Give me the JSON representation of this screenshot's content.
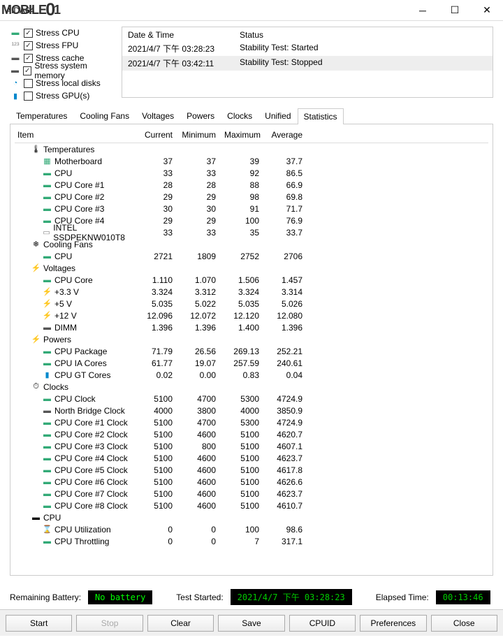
{
  "window": {
    "title": "AIDA64"
  },
  "watermark": "MOBILE01",
  "stress": {
    "items": [
      {
        "icon": "cpu",
        "label": "Stress CPU",
        "checked": true
      },
      {
        "icon": "fpu",
        "label": "Stress FPU",
        "checked": true
      },
      {
        "icon": "cache",
        "label": "Stress cache",
        "checked": true
      },
      {
        "icon": "mem",
        "label": "Stress system memory",
        "checked": true
      },
      {
        "icon": "disk",
        "label": "Stress local disks",
        "checked": false
      },
      {
        "icon": "gpu",
        "label": "Stress GPU(s)",
        "checked": false
      }
    ]
  },
  "log": {
    "headers": {
      "datetime": "Date & Time",
      "status": "Status"
    },
    "rows": [
      {
        "dt": "2021/4/7 下午 03:28:23",
        "status": "Stability Test: Started",
        "alt": false
      },
      {
        "dt": "2021/4/7 下午 03:42:11",
        "status": "Stability Test: Stopped",
        "alt": true
      }
    ]
  },
  "tabs": [
    "Temperatures",
    "Cooling Fans",
    "Voltages",
    "Powers",
    "Clocks",
    "Unified",
    "Statistics"
  ],
  "activeTab": "Statistics",
  "statsHeaders": {
    "item": "Item",
    "current": "Current",
    "minimum": "Minimum",
    "maximum": "Maximum",
    "average": "Average"
  },
  "groups": [
    {
      "icon": "🌡",
      "name": "Temperatures",
      "rows": [
        {
          "icon": "mb",
          "name": "Motherboard",
          "cur": "37",
          "min": "37",
          "max": "39",
          "avg": "37.7"
        },
        {
          "icon": "cpu",
          "name": "CPU",
          "cur": "33",
          "min": "33",
          "max": "92",
          "avg": "86.5"
        },
        {
          "icon": "cpu",
          "name": "CPU Core #1",
          "cur": "28",
          "min": "28",
          "max": "88",
          "avg": "66.9"
        },
        {
          "icon": "cpu",
          "name": "CPU Core #2",
          "cur": "29",
          "min": "29",
          "max": "98",
          "avg": "69.8"
        },
        {
          "icon": "cpu",
          "name": "CPU Core #3",
          "cur": "30",
          "min": "30",
          "max": "91",
          "avg": "71.7"
        },
        {
          "icon": "cpu",
          "name": "CPU Core #4",
          "cur": "29",
          "min": "29",
          "max": "100",
          "avg": "76.9"
        },
        {
          "icon": "ssd",
          "name": "INTEL SSDPEKNW010T8",
          "cur": "33",
          "min": "33",
          "max": "35",
          "avg": "33.7"
        }
      ]
    },
    {
      "icon": "❄",
      "name": "Cooling Fans",
      "rows": [
        {
          "icon": "cpu",
          "name": "CPU",
          "cur": "2721",
          "min": "1809",
          "max": "2752",
          "avg": "2706"
        }
      ]
    },
    {
      "icon": "⚡",
      "name": "Voltages",
      "rows": [
        {
          "icon": "cpu",
          "name": "CPU Core",
          "cur": "1.110",
          "min": "1.070",
          "max": "1.506",
          "avg": "1.457"
        },
        {
          "icon": "v",
          "name": "+3.3 V",
          "cur": "3.324",
          "min": "3.312",
          "max": "3.324",
          "avg": "3.314"
        },
        {
          "icon": "v",
          "name": "+5 V",
          "cur": "5.035",
          "min": "5.022",
          "max": "5.035",
          "avg": "5.026"
        },
        {
          "icon": "v",
          "name": "+12 V",
          "cur": "12.096",
          "min": "12.072",
          "max": "12.120",
          "avg": "12.080"
        },
        {
          "icon": "dimm",
          "name": "DIMM",
          "cur": "1.396",
          "min": "1.396",
          "max": "1.400",
          "avg": "1.396"
        }
      ]
    },
    {
      "icon": "⚡",
      "name": "Powers",
      "rows": [
        {
          "icon": "cpu",
          "name": "CPU Package",
          "cur": "71.79",
          "min": "26.56",
          "max": "269.13",
          "avg": "252.21"
        },
        {
          "icon": "cpu",
          "name": "CPU IA Cores",
          "cur": "61.77",
          "min": "19.07",
          "max": "257.59",
          "avg": "240.61"
        },
        {
          "icon": "gt",
          "name": "CPU GT Cores",
          "cur": "0.02",
          "min": "0.00",
          "max": "0.83",
          "avg": "0.04"
        }
      ]
    },
    {
      "icon": "⏱",
      "name": "Clocks",
      "rows": [
        {
          "icon": "cpu",
          "name": "CPU Clock",
          "cur": "5100",
          "min": "4700",
          "max": "5300",
          "avg": "4724.9"
        },
        {
          "icon": "nb",
          "name": "North Bridge Clock",
          "cur": "4000",
          "min": "3800",
          "max": "4000",
          "avg": "3850.9"
        },
        {
          "icon": "cpu",
          "name": "CPU Core #1 Clock",
          "cur": "5100",
          "min": "4700",
          "max": "5300",
          "avg": "4724.9"
        },
        {
          "icon": "cpu",
          "name": "CPU Core #2 Clock",
          "cur": "5100",
          "min": "4600",
          "max": "5100",
          "avg": "4620.7"
        },
        {
          "icon": "cpu",
          "name": "CPU Core #3 Clock",
          "cur": "5100",
          "min": "800",
          "max": "5100",
          "avg": "4607.1"
        },
        {
          "icon": "cpu",
          "name": "CPU Core #4 Clock",
          "cur": "5100",
          "min": "4600",
          "max": "5100",
          "avg": "4623.7"
        },
        {
          "icon": "cpu",
          "name": "CPU Core #5 Clock",
          "cur": "5100",
          "min": "4600",
          "max": "5100",
          "avg": "4617.8"
        },
        {
          "icon": "cpu",
          "name": "CPU Core #6 Clock",
          "cur": "5100",
          "min": "4600",
          "max": "5100",
          "avg": "4626.6"
        },
        {
          "icon": "cpu",
          "name": "CPU Core #7 Clock",
          "cur": "5100",
          "min": "4600",
          "max": "5100",
          "avg": "4623.7"
        },
        {
          "icon": "cpu",
          "name": "CPU Core #8 Clock",
          "cur": "5100",
          "min": "4600",
          "max": "5100",
          "avg": "4610.7"
        }
      ]
    },
    {
      "icon": "cpu",
      "name": "CPU",
      "rows": [
        {
          "icon": "⌛",
          "name": "CPU Utilization",
          "cur": "0",
          "min": "0",
          "max": "100",
          "avg": "98.6"
        },
        {
          "icon": "cpu",
          "name": "CPU Throttling",
          "cur": "0",
          "min": "0",
          "max": "7",
          "avg": "317.1"
        }
      ]
    }
  ],
  "status": {
    "battery_label": "Remaining Battery:",
    "battery": "No battery",
    "started_label": "Test Started:",
    "started": "2021/4/7 下午 03:28:23",
    "elapsed_label": "Elapsed Time:",
    "elapsed": "00:13:46"
  },
  "buttons": {
    "start": "Start",
    "stop": "Stop",
    "clear": "Clear",
    "save": "Save",
    "cpuid": "CPUID",
    "preferences": "Preferences",
    "close": "Close"
  }
}
